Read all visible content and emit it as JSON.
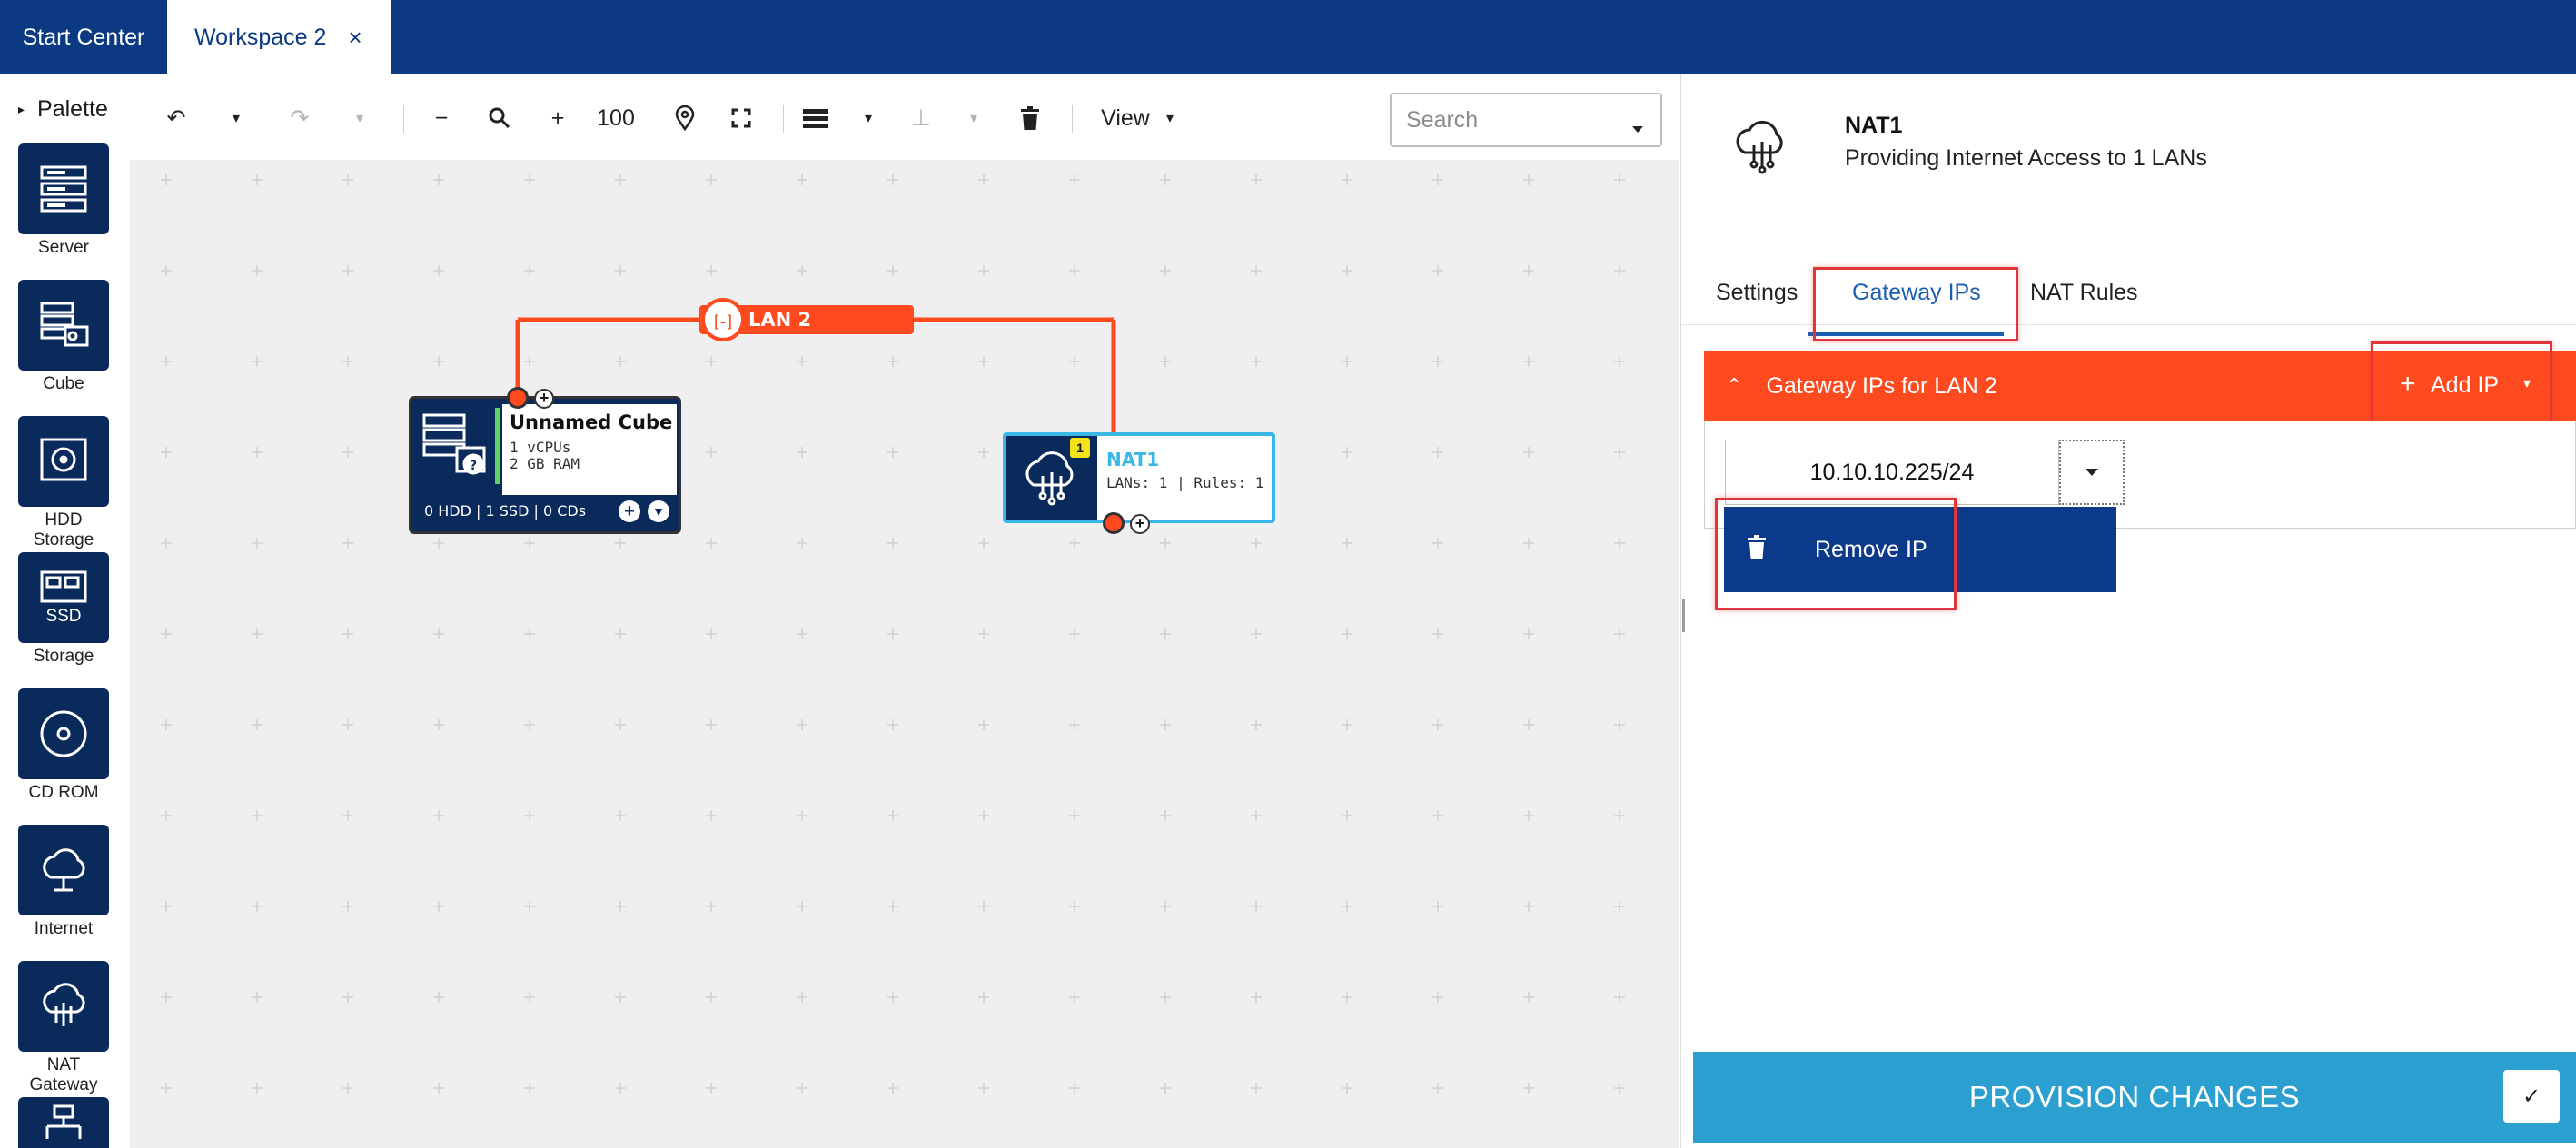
{
  "tabs_top": {
    "start_center": "Start Center",
    "workspace": "Workspace 2",
    "close": "×"
  },
  "palette": {
    "title": "Palette",
    "items": [
      {
        "label": "Server",
        "icon": "server-icon"
      },
      {
        "label": "Cube",
        "icon": "cube-icon"
      },
      {
        "label": "HDD\nStorage",
        "icon": "hdd-icon"
      },
      {
        "label": "SSD\nStorage",
        "icon": "ssd-icon"
      },
      {
        "label": "CD ROM",
        "icon": "cdrom-icon"
      },
      {
        "label": "Internet",
        "icon": "internet-icon"
      },
      {
        "label": "NAT\nGateway",
        "icon": "nat-gateway-icon"
      }
    ]
  },
  "toolbar": {
    "zoom": "100",
    "view": "View",
    "search_placeholder": "Search"
  },
  "canvas": {
    "lan_label": "LAN 2",
    "cube": {
      "name": "Unnamed Cube",
      "cpus": "1 vCPUs",
      "ram": "2 GB RAM",
      "footer": "0 HDD | 1 SSD | 0 CDs"
    },
    "nat": {
      "name": "NAT1",
      "info": "LANs: 1 | Rules: 1",
      "badge": "1"
    }
  },
  "panel": {
    "title": "NAT1",
    "subtitle": "Providing Internet Access to 1 LANs",
    "tabs": [
      "Settings",
      "Gateway IPs",
      "NAT Rules"
    ],
    "active_tab": "Gateway IPs",
    "section_title": "Gateway IPs for LAN 2",
    "add_ip": "Add IP",
    "ip_value": "10.10.10.225/24",
    "remove_ip": "Remove IP",
    "provision": "PROVISION CHANGES"
  },
  "colors": {
    "topbar": "#0b3a82",
    "accent_orange": "#ff4a1f",
    "link_blue": "#1b5fb3",
    "node_dark": "#0a2a5c",
    "provision_blue": "#2a9fd0"
  }
}
